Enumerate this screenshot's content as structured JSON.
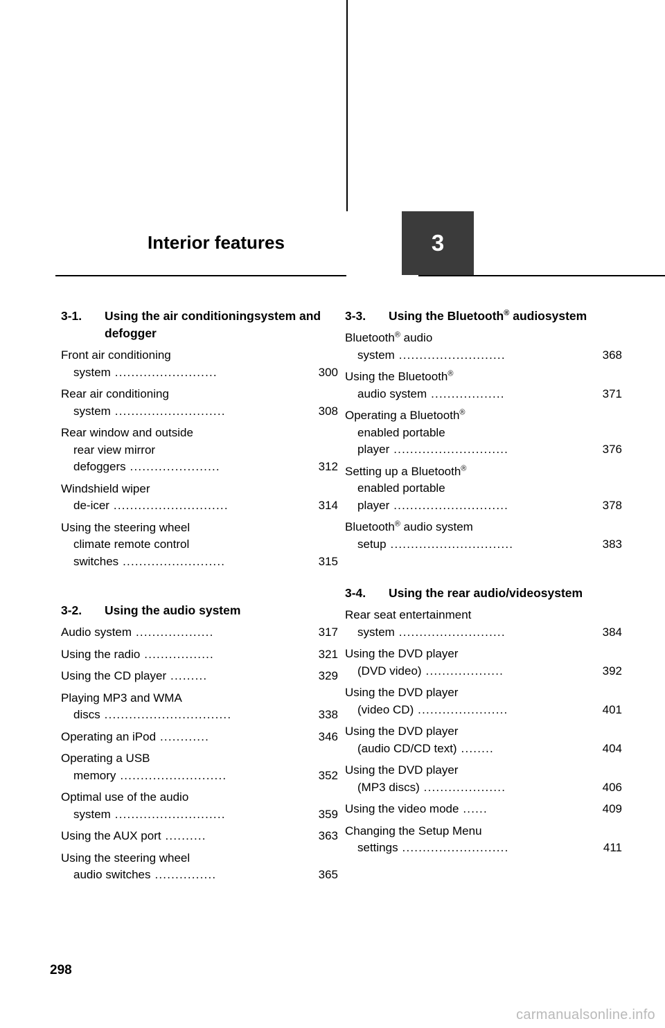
{
  "chapter": {
    "title": "Interior features",
    "number": "3"
  },
  "folio": "298",
  "watermark": "carmanualsonline.info",
  "columns": {
    "left": [
      {
        "num": "3-1.",
        "title_line1": "Using the air conditioning",
        "title_line2": "system and defogger",
        "entries": [
          {
            "line1": "Front air conditioning",
            "line2": "system",
            "dots": ".........................",
            "page": "300"
          },
          {
            "line1": "Rear air conditioning",
            "line2": "system",
            "dots": "...........................",
            "page": "308"
          },
          {
            "line1": "Rear window and outside",
            "line2": "rear view mirror",
            "line3": "defoggers",
            "dots": "......................",
            "page": "312"
          },
          {
            "line1": "Windshield wiper",
            "line2": "de-icer",
            "dots": "............................",
            "page": "314"
          },
          {
            "line1": "Using the steering wheel",
            "line2": "climate remote control",
            "line3": "switches",
            "dots": ".........................",
            "page": "315"
          }
        ]
      },
      {
        "num": "3-2.",
        "title_line1": "Using the audio system",
        "title_line2": "",
        "entries": [
          {
            "line1": "Audio system",
            "dots": "...................",
            "page": "317"
          },
          {
            "line1": "Using the radio",
            "dots": ".................",
            "page": "321"
          },
          {
            "line1": "Using the CD player",
            "dots": ".........",
            "page": "329"
          },
          {
            "line1": "Playing MP3 and WMA",
            "line2": "discs",
            "dots": "...............................",
            "page": "338"
          },
          {
            "line1": "Operating an iPod",
            "dots": "............",
            "page": "346"
          },
          {
            "line1": "Operating a USB",
            "line2": "memory",
            "dots": "..........................",
            "page": "352"
          },
          {
            "line1": "Optimal use of the audio",
            "line2": "system",
            "dots": "...........................",
            "page": "359"
          },
          {
            "line1": "Using the AUX port",
            "dots": "..........",
            "page": "363"
          },
          {
            "line1": "Using the steering wheel",
            "line2": "audio switches",
            "dots": "...............",
            "page": "365"
          }
        ]
      }
    ],
    "right": [
      {
        "num": "3-3.",
        "title_line1": "Using the Bluetooth",
        "title_sup": "®",
        "title_line1_tail": " audio",
        "title_line2": "system",
        "entries": [
          {
            "line1": "Bluetooth",
            "sup1": "®",
            "line1_tail": " audio",
            "line2": "system",
            "dots": "..........................",
            "page": "368"
          },
          {
            "line1": "Using the Bluetooth",
            "sup1": "®",
            "line1_tail": "",
            "line2": "audio system",
            "dots": "..................",
            "page": "371"
          },
          {
            "line1": "Operating a Bluetooth",
            "sup1": "®",
            "line1_tail": "",
            "line2": "enabled portable",
            "line3": "player",
            "dots": "............................",
            "page": "376"
          },
          {
            "line1": "Setting up a Bluetooth",
            "sup1": "®",
            "line1_tail": "",
            "line2": "enabled portable",
            "line3": "player",
            "dots": "............................",
            "page": "378"
          },
          {
            "line1": "Bluetooth",
            "sup1": "®",
            "line1_tail": " audio system",
            "line2": "setup",
            "dots": "..............................",
            "page": "383"
          }
        ]
      },
      {
        "num": "3-4.",
        "title_line1": "Using the rear audio/video",
        "title_line2": "system",
        "entries": [
          {
            "line1": "Rear seat entertainment",
            "line2": "system",
            "dots": "..........................",
            "page": "384"
          },
          {
            "line1": "Using the DVD player",
            "line2": "(DVD video)",
            "dots": "...................",
            "page": "392"
          },
          {
            "line1": "Using the DVD player",
            "line2": "(video CD)",
            "dots": "......................",
            "page": "401"
          },
          {
            "line1": "Using the DVD player",
            "line2": "(audio CD/CD text)",
            "dots": "........",
            "page": "404"
          },
          {
            "line1": "Using the DVD player",
            "line2": "(MP3 discs)",
            "dots": "....................",
            "page": "406"
          },
          {
            "line1": "Using the video mode",
            "dots": "......",
            "page": "409"
          },
          {
            "line1": "Changing the Setup Menu",
            "line2": "settings",
            "dots": "..........................",
            "page": "411"
          }
        ]
      }
    ]
  }
}
